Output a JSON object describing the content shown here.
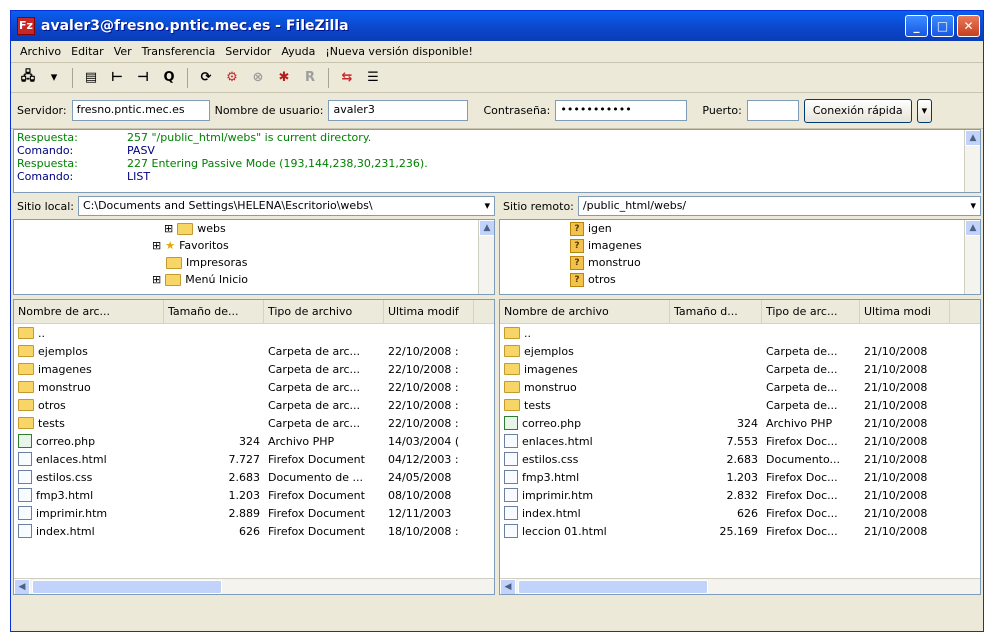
{
  "window": {
    "title": "avaler3@fresno.pntic.mec.es - FileZilla"
  },
  "menu": {
    "items": [
      "Archivo",
      "Editar",
      "Ver",
      "Transferencia",
      "Servidor",
      "Ayuda",
      "¡Nueva versión disponible!"
    ]
  },
  "quickconnect": {
    "server_label": "Servidor:",
    "server_value": "fresno.pntic.mec.es",
    "user_label": "Nombre de usuario:",
    "user_value": "avaler3",
    "pass_label": "Contraseña:",
    "pass_value": "•••••••••••",
    "port_label": "Puerto:",
    "port_value": "",
    "connect_label": "Conexión rápida"
  },
  "log": [
    {
      "type": "Respuesta:",
      "text": "257 \"/public_html/webs\" is current directory."
    },
    {
      "type": "Comando:",
      "text": "PASV"
    },
    {
      "type": "Respuesta:",
      "text": "227 Entering Passive Mode (193,144,238,30,231,236)."
    },
    {
      "type": "Comando:",
      "text": "LIST"
    }
  ],
  "local": {
    "site_label": "Sitio local:",
    "path": "C:\\Documents and Settings\\HELENA\\Escritorio\\webs\\",
    "tree": [
      "webs",
      "Favoritos",
      "Impresoras",
      "Menú Inicio"
    ],
    "headers": [
      "Nombre de arc...",
      "Tamaño de...",
      "Tipo de archivo",
      "Ultima modif"
    ],
    "files": [
      {
        "name": "..",
        "size": "",
        "type": "",
        "date": ""
      },
      {
        "name": "ejemplos",
        "size": "",
        "type": "Carpeta de arc...",
        "date": "22/10/2008 :"
      },
      {
        "name": "imagenes",
        "size": "",
        "type": "Carpeta de arc...",
        "date": "22/10/2008 :"
      },
      {
        "name": "monstruo",
        "size": "",
        "type": "Carpeta de arc...",
        "date": "22/10/2008 :"
      },
      {
        "name": "otros",
        "size": "",
        "type": "Carpeta de arc...",
        "date": "22/10/2008 :"
      },
      {
        "name": "tests",
        "size": "",
        "type": "Carpeta de arc...",
        "date": "22/10/2008 :"
      },
      {
        "name": "correo.php",
        "size": "324",
        "type": "Archivo PHP",
        "date": "14/03/2004 ("
      },
      {
        "name": "enlaces.html",
        "size": "7.727",
        "type": "Firefox Document",
        "date": "04/12/2003 :"
      },
      {
        "name": "estilos.css",
        "size": "2.683",
        "type": "Documento de ...",
        "date": "24/05/2008"
      },
      {
        "name": "fmp3.html",
        "size": "1.203",
        "type": "Firefox Document",
        "date": "08/10/2008"
      },
      {
        "name": "imprimir.htm",
        "size": "2.889",
        "type": "Firefox Document",
        "date": "12/11/2003"
      },
      {
        "name": "index.html",
        "size": "626",
        "type": "Firefox Document",
        "date": "18/10/2008 :"
      }
    ]
  },
  "remote": {
    "site_label": "Sitio remoto:",
    "path": "/public_html/webs/",
    "tree": [
      "igen",
      "imagenes",
      "monstruo",
      "otros"
    ],
    "headers": [
      "Nombre de archivo",
      "Tamaño d...",
      "Tipo de arc...",
      "Ultima modi"
    ],
    "files": [
      {
        "name": "..",
        "size": "",
        "type": "",
        "date": ""
      },
      {
        "name": "ejemplos",
        "size": "",
        "type": "Carpeta de...",
        "date": "21/10/2008"
      },
      {
        "name": "imagenes",
        "size": "",
        "type": "Carpeta de...",
        "date": "21/10/2008"
      },
      {
        "name": "monstruo",
        "size": "",
        "type": "Carpeta de...",
        "date": "21/10/2008"
      },
      {
        "name": "tests",
        "size": "",
        "type": "Carpeta de...",
        "date": "21/10/2008"
      },
      {
        "name": "correo.php",
        "size": "324",
        "type": "Archivo PHP",
        "date": "21/10/2008"
      },
      {
        "name": "enlaces.html",
        "size": "7.553",
        "type": "Firefox Doc...",
        "date": "21/10/2008"
      },
      {
        "name": "estilos.css",
        "size": "2.683",
        "type": "Documento...",
        "date": "21/10/2008"
      },
      {
        "name": "fmp3.html",
        "size": "1.203",
        "type": "Firefox Doc...",
        "date": "21/10/2008"
      },
      {
        "name": "imprimir.htm",
        "size": "2.832",
        "type": "Firefox Doc...",
        "date": "21/10/2008"
      },
      {
        "name": "index.html",
        "size": "626",
        "type": "Firefox Doc...",
        "date": "21/10/2008"
      },
      {
        "name": "leccion 01.html",
        "size": "25.169",
        "type": "Firefox Doc...",
        "date": "21/10/2008"
      }
    ]
  }
}
